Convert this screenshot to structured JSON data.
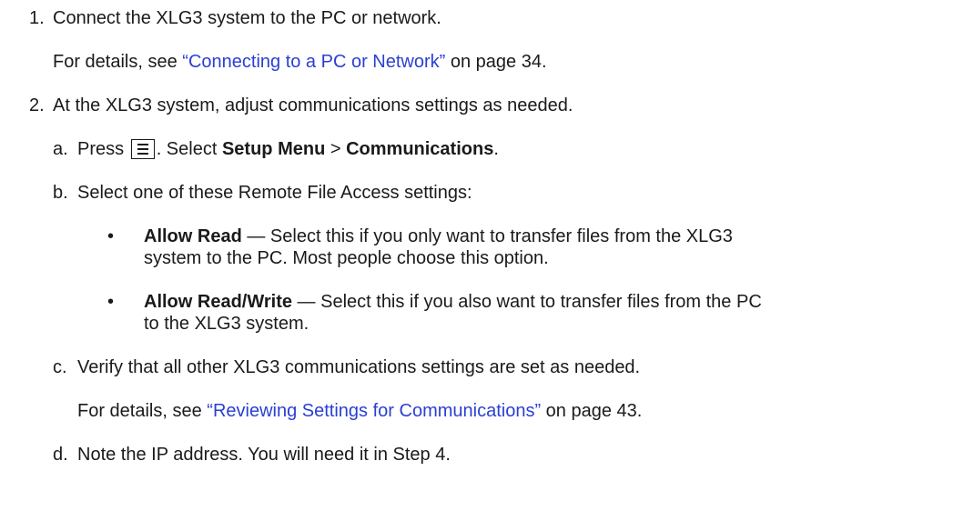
{
  "steps": [
    {
      "num": "1.",
      "text": "Connect the XLG3 system to the PC or network."
    },
    {
      "num": "2.",
      "text": "At the XLG3 system, adjust communications settings as needed."
    }
  ],
  "details1": {
    "prefix": "For details, see ",
    "link": "“Connecting to a PC or Network”",
    "suffix": " on page 34."
  },
  "sub_a": {
    "num": "a.",
    "press": "Press ",
    "after_icon": ". Select ",
    "bold1": "Setup Menu",
    "sep": " > ",
    "bold2": "Communications",
    "end": "."
  },
  "sub_b": {
    "num": "b.",
    "text": "Select one of these Remote File Access settings:"
  },
  "bullets": [
    {
      "mark": "•",
      "bold": "Allow Read",
      "text1": " — Select this if you only want to transfer files from the XLG3",
      "text2": "system to the PC. Most people choose this option."
    },
    {
      "mark": "•",
      "bold": "Allow Read/Write",
      "text1": " — Select this if you also want to transfer files from the PC",
      "text2": "to the XLG3 system."
    }
  ],
  "sub_c": {
    "num": "c.",
    "text": "Verify that all other XLG3 communications settings are set as needed."
  },
  "details2": {
    "prefix": "For details, see ",
    "link": "“Reviewing Settings for Communications”",
    "suffix": " on page 43."
  },
  "sub_d": {
    "num": "d.",
    "text": "Note the IP address. You will need it in Step 4."
  },
  "colors": {
    "link": "#2a3fd4",
    "text": "#1a1a1a"
  },
  "icons": {
    "menu": "menu-list-icon"
  }
}
